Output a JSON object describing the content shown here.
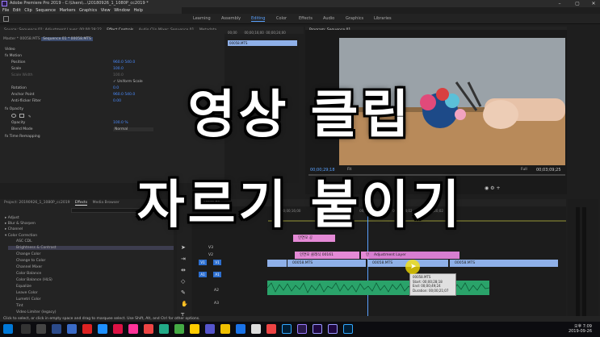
{
  "window": {
    "title": "Adobe Premiere Pro 2019 - C:\\Users\\...\\20180926_1_1080P_cc2019 *",
    "app_icon": "Pr"
  },
  "menu": [
    "File",
    "Edit",
    "Clip",
    "Sequence",
    "Markers",
    "Graphics",
    "View",
    "Window",
    "Help"
  ],
  "workspaces": [
    "Learning",
    "Assembly",
    "Editing",
    "Color",
    "Effects",
    "Audio",
    "Graphics",
    "Libraries"
  ],
  "workspace_active": "Editing",
  "source_tabs": [
    "Source: Sequence 01: Adjustment Layer: 00;00;28;22",
    "Effect Controls",
    "Audio Clip Mixer: Sequence 01",
    "Metadata"
  ],
  "source_tab_active": "Effect Controls",
  "ec_sub": {
    "master": "Master * 00058.MTS",
    "seq": "Sequence 01 * 00058.MTS"
  },
  "ec_rows": [
    {
      "label": "Video",
      "val": ""
    },
    {
      "label": "fx  Motion",
      "val": ""
    },
    {
      "label": "Position",
      "val": "960.0    540.0"
    },
    {
      "label": "Scale",
      "val": "100.0"
    },
    {
      "label": "Scale Width",
      "val": "100.0"
    },
    {
      "label": "",
      "val": "✓ Uniform Scale"
    },
    {
      "label": "Rotation",
      "val": "0.0"
    },
    {
      "label": "Anchor Point",
      "val": "960.0    540.0"
    },
    {
      "label": "Anti-flicker Filter",
      "val": "0.00"
    },
    {
      "label": "fx  Opacity",
      "val": ""
    },
    {
      "label": "",
      "val": ""
    },
    {
      "label": "Opacity",
      "val": "100.0 %"
    },
    {
      "label": "Blend Mode",
      "val": "Normal"
    },
    {
      "label": "fx  Time Remapping",
      "val": ""
    }
  ],
  "ec_timeline": {
    "times": [
      "00;00",
      "00;00;16;00",
      "00;00;24;00"
    ],
    "clip": "00058.MTS"
  },
  "program": {
    "title": "Program: Sequence 01",
    "timecode_left": "00;00;29;18",
    "fit": "Fit",
    "quality": "Full",
    "timecode_right": "00;03;09;25"
  },
  "project": {
    "tabs": [
      "Project: 20190926_1_1080P_cc2019",
      "Effects",
      "Media Browser"
    ],
    "active": "Effects"
  },
  "effects_list": [
    "Adjust",
    "Blur & Sharpen",
    "Channel",
    "Color Correction",
    "ASC CDL",
    "Brightness & Contrast",
    "Change Color",
    "Change to Color",
    "Channel Mixer",
    "Color Balance",
    "Color Balance (HLS)",
    "Equalize",
    "Leave Color",
    "Lumetri Color",
    "Tint",
    "Video Limiter (legacy)"
  ],
  "effects_selected": "Brightness & Contrast",
  "timeline": {
    "tab": "Sequence 01",
    "timecode": "00;00;29;18",
    "ruler": [
      "00;00;16;00",
      "00;00;32;00",
      "00;00;48;00",
      "00;01;04;02",
      "00;01;20;02"
    ],
    "tracks": [
      "V3",
      "V2",
      "V1",
      "A1",
      "A2",
      "A3"
    ],
    "clips": [
      "인연모 공",
      "인연모 클래식 00161",
      "인연모 클래식 00161",
      "Adjustment Layer",
      "00058.MTS",
      "00058.MTS",
      "00058.MTS"
    ]
  },
  "tooltip": {
    "name": "00058.MTS",
    "start": "Start: 00;00;28;18",
    "end": "End: 00;00;49;24",
    "duration": "Duration: 00;00;21;07"
  },
  "overlay": {
    "line1": "영상 클립",
    "line2": "자르기 붙이기"
  },
  "status": "Click to select, or click in empty space and drag to marquee select. Use Shift, Alt, and Ctrl for other options.",
  "clock": {
    "time": "오후 7:09",
    "date": "2019-09-26"
  },
  "colors": {
    "accent": "#5aa2ff",
    "clip_pink": "#e48ad6",
    "clip_blue": "#8fb0e8",
    "audio": "#2aa36a",
    "program_bg": "#8a8f93"
  }
}
